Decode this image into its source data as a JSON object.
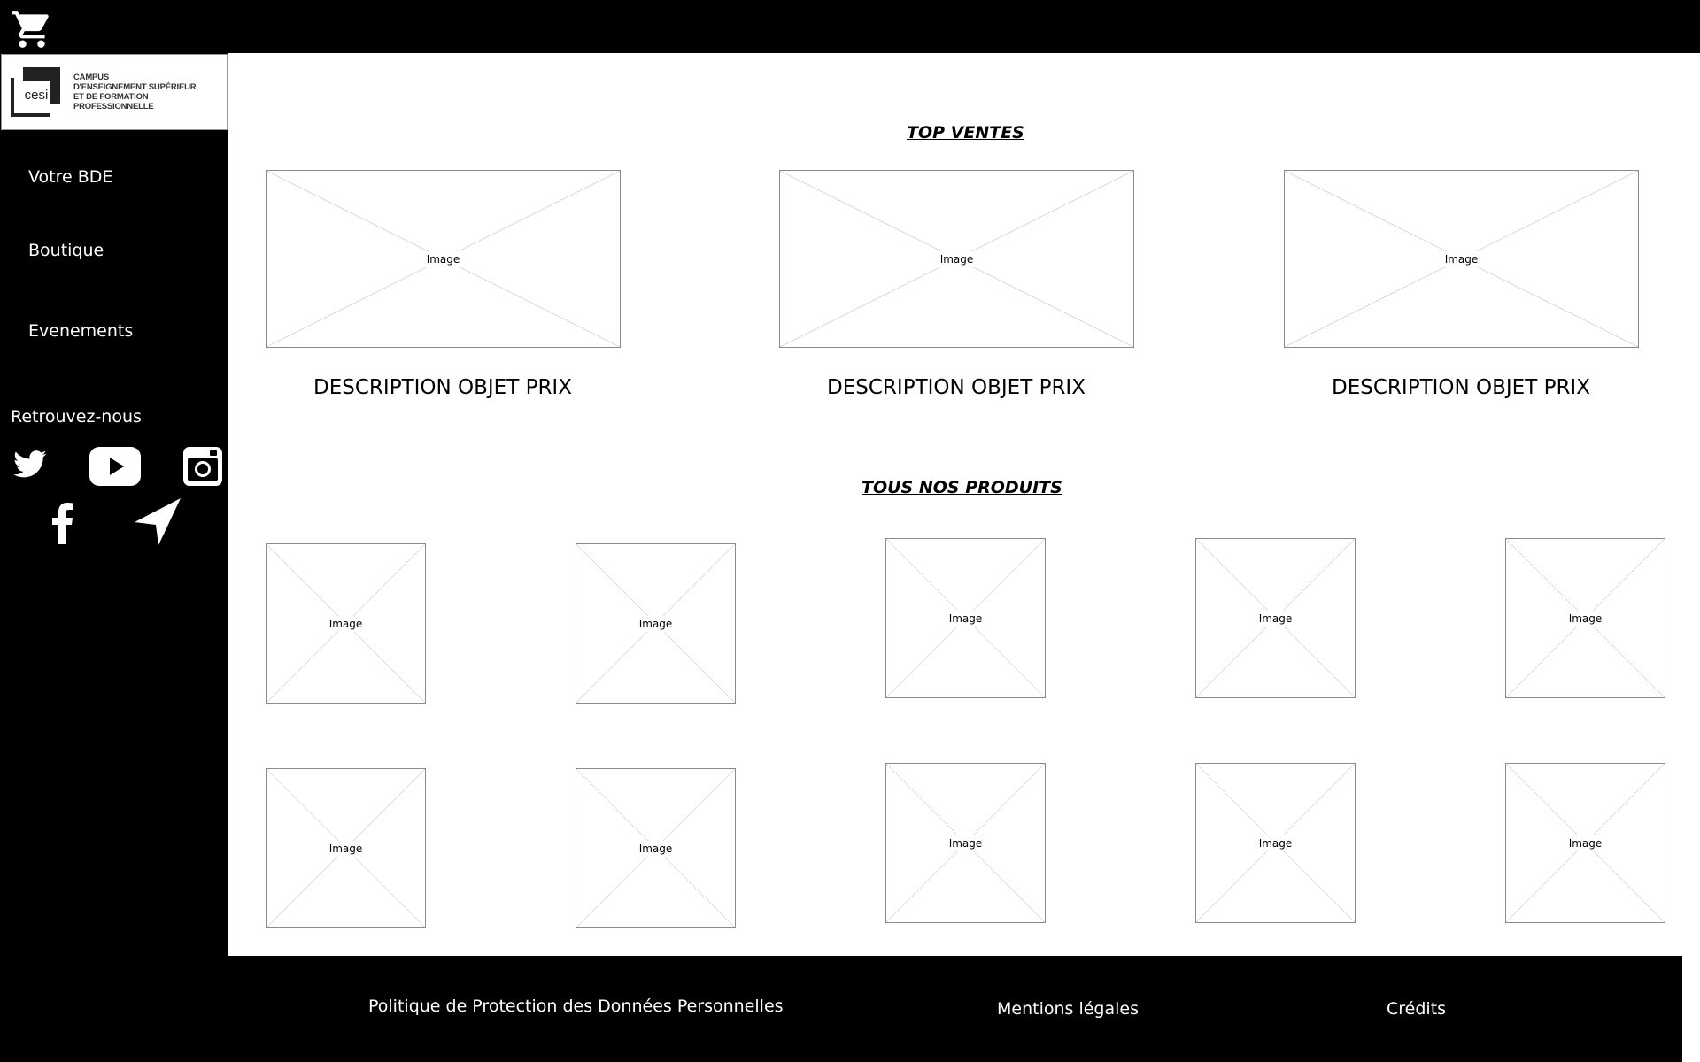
{
  "header": {
    "cart_icon": "shopping-cart-icon"
  },
  "sidebar": {
    "logo": {
      "mark_text": "cesi",
      "line1": "CAMPUS",
      "line2": "D'ENSEIGNEMENT SUPÉRIEUR",
      "line3": "ET DE FORMATION PROFESSIONNELLE"
    },
    "nav": [
      {
        "label": "Votre BDE"
      },
      {
        "label": "Boutique"
      },
      {
        "label": "Evenements"
      }
    ],
    "social_title": "Retrouvez-nous",
    "social_icons": [
      "twitter-icon",
      "youtube-icon",
      "instagram-icon",
      "facebook-icon",
      "location-arrow-icon"
    ]
  },
  "top_sales": {
    "title": "TOP VENTES",
    "items": [
      {
        "image_label": "Image",
        "description": "DESCRIPTION OBJET PRIX"
      },
      {
        "image_label": "Image",
        "description": "DESCRIPTION OBJET PRIX"
      },
      {
        "image_label": "Image",
        "description": "DESCRIPTION OBJET PRIX"
      }
    ]
  },
  "all_products": {
    "title": "TOUS NOS PRODUITS",
    "image_label": "Image"
  },
  "footer": {
    "privacy": "Politique de Protection des Données Personnelles",
    "legal": "Mentions légales",
    "credits": "Crédits"
  },
  "colors": {
    "background": "#ffffff",
    "bars": "#000000",
    "placeholder_border": "#8a8a8a"
  }
}
